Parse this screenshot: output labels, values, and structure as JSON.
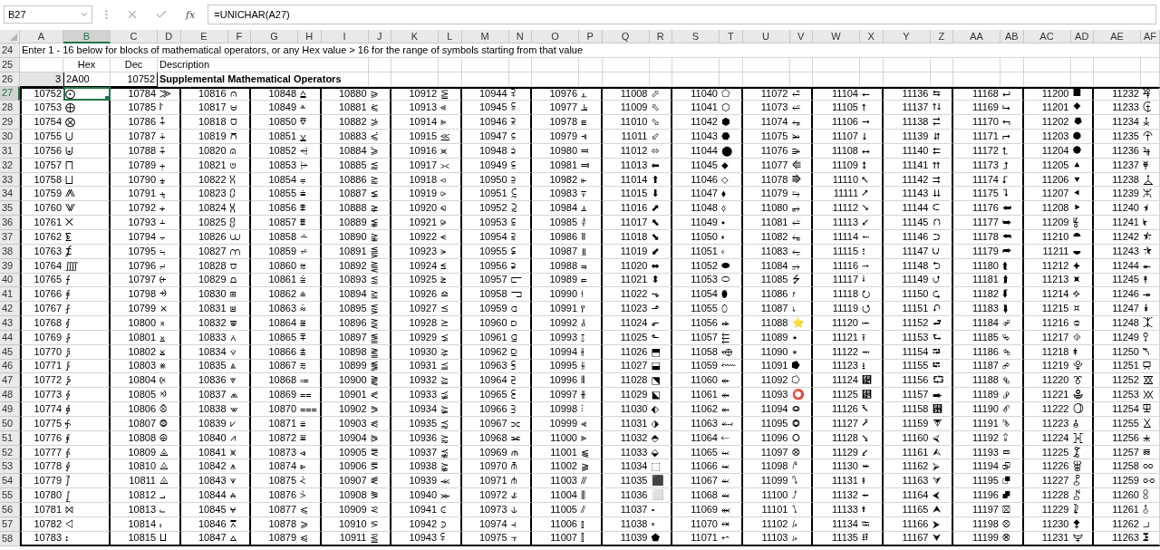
{
  "formula_bar": {
    "name_box": "B27",
    "function_label": "fx",
    "formula": "=UNICHAR(A27)"
  },
  "columns": [
    {
      "label": "A",
      "selected": false
    },
    {
      "label": "B",
      "selected": true
    },
    {
      "label": "C",
      "selected": false
    },
    {
      "label": "D",
      "selected": false
    },
    {
      "label": "E",
      "selected": false
    },
    {
      "label": "F",
      "selected": false
    },
    {
      "label": "G",
      "selected": false
    },
    {
      "label": "H",
      "selected": false
    },
    {
      "label": "I",
      "selected": false
    },
    {
      "label": "J",
      "selected": false
    },
    {
      "label": "K",
      "selected": false
    },
    {
      "label": "L",
      "selected": false
    },
    {
      "label": "M",
      "selected": false
    },
    {
      "label": "N",
      "selected": false
    },
    {
      "label": "O",
      "selected": false
    },
    {
      "label": "P",
      "selected": false
    },
    {
      "label": "Q",
      "selected": false
    },
    {
      "label": "R",
      "selected": false
    },
    {
      "label": "S",
      "selected": false
    },
    {
      "label": "T",
      "selected": false
    },
    {
      "label": "U",
      "selected": false
    },
    {
      "label": "V",
      "selected": false
    },
    {
      "label": "W",
      "selected": false
    },
    {
      "label": "X",
      "selected": false
    },
    {
      "label": "Y",
      "selected": false
    },
    {
      "label": "Z",
      "selected": false
    },
    {
      "label": "AA",
      "selected": false
    },
    {
      "label": "AB",
      "selected": false
    },
    {
      "label": "AC",
      "selected": false
    },
    {
      "label": "AD",
      "selected": false
    },
    {
      "label": "AE",
      "selected": false
    },
    {
      "label": "AF",
      "selected": false
    }
  ],
  "rows": [
    {
      "kind": "note",
      "number": "24",
      "selected": false,
      "text": "Enter 1 - 16 below for blocks of mathematical operators, or any Hex value > 16 for the range of symbols starting from that value"
    },
    {
      "kind": "labels",
      "number": "25",
      "selected": false,
      "hex": "Hex",
      "dec": "Dec",
      "description": "Description"
    },
    {
      "kind": "input",
      "number": "26",
      "selected": false,
      "block": "3",
      "hex": "2A00",
      "dec": "10752",
      "description": "Supplemental Mathematical Operators"
    },
    {
      "kind": "data",
      "number": "27",
      "selected": true,
      "cells": [
        "10752",
        "⨀",
        "10784",
        "⨠",
        "10816",
        "⩀",
        "10848",
        "⩠",
        "10880",
        "⪀",
        "10912",
        "⪠",
        "10944",
        "⫀",
        "10976",
        "⫠",
        "11008",
        "⬀",
        "11040",
        "⬠",
        "11072",
        "⭀",
        "11104",
        "⭠",
        "11136",
        "⮀",
        "11168",
        "⮠",
        "11200",
        "⯀",
        "11232",
        "⯠"
      ]
    },
    {
      "kind": "data",
      "number": "28",
      "selected": false,
      "cells": [
        "10753",
        "⨁",
        "10785",
        "⨡",
        "10817",
        "⩁",
        "10849",
        "⩡",
        "10881",
        "⪁",
        "10913",
        "⪡",
        "10945",
        "⫁",
        "10977",
        "⫡",
        "11009",
        "⬁",
        "11041",
        "⬡",
        "11073",
        "⭁",
        "11105",
        "⭡",
        "11137",
        "⮁",
        "11169",
        "⮡",
        "11201",
        "⯁",
        "11233",
        "⯡"
      ]
    },
    {
      "kind": "data",
      "number": "29",
      "selected": false,
      "cells": [
        "10754",
        "⨂",
        "10786",
        "⨢",
        "10818",
        "⩂",
        "10850",
        "⩢",
        "10882",
        "⪂",
        "10914",
        "⪢",
        "10946",
        "⫂",
        "10978",
        "⫢",
        "11010",
        "⬂",
        "11042",
        "⬢",
        "11074",
        "⭂",
        "11106",
        "⭢",
        "11138",
        "⮂",
        "11170",
        "⮢",
        "11202",
        "⯂",
        "11234",
        "⯢"
      ]
    },
    {
      "kind": "data",
      "number": "30",
      "selected": false,
      "cells": [
        "10755",
        "⨃",
        "10787",
        "⨣",
        "10819",
        "⩃",
        "10851",
        "⩣",
        "10883",
        "⪃",
        "10915",
        "⪣",
        "10947",
        "⫃",
        "10979",
        "⫣",
        "11011",
        "⬃",
        "11043",
        "⬣",
        "11075",
        "⭃",
        "11107",
        "⭣",
        "11139",
        "⮃",
        "11171",
        "⮣",
        "11203",
        "⯃",
        "11235",
        "⯣"
      ]
    },
    {
      "kind": "data",
      "number": "31",
      "selected": false,
      "cells": [
        "10756",
        "⨄",
        "10788",
        "⨤",
        "10820",
        "⩄",
        "10852",
        "⩤",
        "10884",
        "⪄",
        "10916",
        "⪤",
        "10948",
        "⫄",
        "10980",
        "⫤",
        "11012",
        "⬄",
        "11044",
        "⬤",
        "11076",
        "⭄",
        "11108",
        "⭤",
        "11140",
        "⮄",
        "11172",
        "⮤",
        "11204",
        "⯄",
        "11236",
        "⯤"
      ]
    },
    {
      "kind": "data",
      "number": "32",
      "selected": false,
      "cells": [
        "10757",
        "⨅",
        "10789",
        "⨥",
        "10821",
        "⩅",
        "10853",
        "⩥",
        "10885",
        "⪅",
        "10917",
        "⪥",
        "10949",
        "⫅",
        "10981",
        "⫥",
        "11013",
        "⬅",
        "11045",
        "⬥",
        "11077",
        "⭅",
        "11109",
        "⭥",
        "11141",
        "⮅",
        "11173",
        "⮥",
        "11205",
        "⯅",
        "11237",
        "⯥"
      ]
    },
    {
      "kind": "data",
      "number": "33",
      "selected": false,
      "cells": [
        "10758",
        "⨆",
        "10790",
        "⨦",
        "10822",
        "⩆",
        "10854",
        "⩦",
        "10886",
        "⪆",
        "10918",
        "⪦",
        "10950",
        "⫆",
        "10982",
        "⫦",
        "11014",
        "⬆",
        "11046",
        "⬦",
        "11078",
        "⭆",
        "11110",
        "⭦",
        "11142",
        "⮆",
        "11174",
        "⮦",
        "11206",
        "⯆",
        "11238",
        "⯦"
      ]
    },
    {
      "kind": "data",
      "number": "34",
      "selected": false,
      "cells": [
        "10759",
        "⨇",
        "10791",
        "⨧",
        "10823",
        "⩇",
        "10855",
        "⩧",
        "10887",
        "⪇",
        "10919",
        "⪧",
        "10951",
        "⫇",
        "10983",
        "⫧",
        "11015",
        "⬇",
        "11047",
        "⬧",
        "11079",
        "⭇",
        "11111",
        "⭧",
        "11143",
        "⮇",
        "11175",
        "⮧",
        "11207",
        "⯇",
        "11239",
        "⯧"
      ]
    },
    {
      "kind": "data",
      "number": "35",
      "selected": false,
      "cells": [
        "10760",
        "⨈",
        "10792",
        "⨨",
        "10824",
        "⩈",
        "10856",
        "⩨",
        "10888",
        "⪈",
        "10920",
        "⪨",
        "10952",
        "⫈",
        "10984",
        "⫨",
        "11016",
        "⬈",
        "11048",
        "⬨",
        "11080",
        "⭈",
        "11112",
        "⭨",
        "11144",
        "⮈",
        "11176",
        "⮨",
        "11208",
        "⯈",
        "11240",
        "⯨"
      ]
    },
    {
      "kind": "data",
      "number": "36",
      "selected": false,
      "cells": [
        "10761",
        "⨉",
        "10793",
        "⨩",
        "10825",
        "⩉",
        "10857",
        "⩩",
        "10889",
        "⪉",
        "10921",
        "⪩",
        "10953",
        "⫉",
        "10985",
        "⫩",
        "11017",
        "⬉",
        "11049",
        "⬩",
        "11081",
        "⭉",
        "11113",
        "⭩",
        "11145",
        "⮉",
        "11177",
        "⮩",
        "11209",
        "⯉",
        "11241",
        "⯩"
      ]
    },
    {
      "kind": "data",
      "number": "37",
      "selected": false,
      "cells": [
        "10762",
        "⨊",
        "10794",
        "⨪",
        "10826",
        "⩊",
        "10858",
        "⩪",
        "10890",
        "⪊",
        "10922",
        "⪪",
        "10954",
        "⫊",
        "10986",
        "⫪",
        "11018",
        "⬊",
        "11050",
        "⬪",
        "11082",
        "⭊",
        "11114",
        "⭪",
        "11146",
        "⮊",
        "11178",
        "⮪",
        "11210",
        "⯊",
        "11242",
        "⯪"
      ]
    },
    {
      "kind": "data",
      "number": "38",
      "selected": false,
      "cells": [
        "10763",
        "⨋",
        "10795",
        "⨫",
        "10827",
        "⩋",
        "10859",
        "⩫",
        "10891",
        "⪋",
        "10923",
        "⪫",
        "10955",
        "⫋",
        "10987",
        "⫫",
        "11019",
        "⬋",
        "11051",
        "⬫",
        "11083",
        "⭋",
        "11115",
        "⭫",
        "11147",
        "⮋",
        "11179",
        "⮫",
        "11211",
        "⯋",
        "11243",
        "⯫"
      ]
    },
    {
      "kind": "data",
      "number": "39",
      "selected": false,
      "cells": [
        "10764",
        "⨌",
        "10796",
        "⨬",
        "10828",
        "⩌",
        "10860",
        "⩬",
        "10892",
        "⪌",
        "10924",
        "⪬",
        "10956",
        "⫌",
        "10988",
        "⫬",
        "11020",
        "⬌",
        "11052",
        "⬬",
        "11084",
        "⭌",
        "11116",
        "⭬",
        "11148",
        "⮌",
        "11180",
        "⮬",
        "11212",
        "⯌",
        "11244",
        "⯬"
      ]
    },
    {
      "kind": "data",
      "number": "40",
      "selected": false,
      "cells": [
        "10765",
        "⨍",
        "10797",
        "⨭",
        "10829",
        "⩍",
        "10861",
        "⩭",
        "10893",
        "⪍",
        "10925",
        "⪭",
        "10957",
        "⫍",
        "10989",
        "⫭",
        "11021",
        "⬍",
        "11053",
        "⬭",
        "11085",
        "⭍",
        "11117",
        "⭭",
        "11149",
        "⮍",
        "11181",
        "⮭",
        "11213",
        "⯍",
        "11245",
        "⯭"
      ]
    },
    {
      "kind": "data",
      "number": "41",
      "selected": false,
      "cells": [
        "10766",
        "⨎",
        "10798",
        "⨮",
        "10830",
        "⩎",
        "10862",
        "⩮",
        "10894",
        "⪎",
        "10926",
        "⪮",
        "10958",
        "⫎",
        "10990",
        "⫮",
        "11022",
        "⬎",
        "11054",
        "⬮",
        "11086",
        "⭎",
        "11118",
        "⭮",
        "11150",
        "⮎",
        "11182",
        "⮮",
        "11214",
        "⯎",
        "11246",
        "⯮"
      ]
    },
    {
      "kind": "data",
      "number": "42",
      "selected": false,
      "cells": [
        "10767",
        "⨏",
        "10799",
        "⨯",
        "10831",
        "⩏",
        "10863",
        "⩯",
        "10895",
        "⪏",
        "10927",
        "⪯",
        "10959",
        "⫏",
        "10991",
        "⫯",
        "11023",
        "⬏",
        "11055",
        "⬯",
        "11087",
        "⭏",
        "11119",
        "⭯",
        "11151",
        "⮏",
        "11183",
        "⮯",
        "11215",
        "⯏",
        "11247",
        "⯯"
      ]
    },
    {
      "kind": "data",
      "number": "43",
      "selected": false,
      "cells": [
        "10768",
        "⨐",
        "10800",
        "⨰",
        "10832",
        "⩐",
        "10864",
        "⩰",
        "10896",
        "⪐",
        "10928",
        "⪰",
        "10960",
        "⫐",
        "10992",
        "⫰",
        "11024",
        "⬐",
        "11056",
        "⬰",
        "11088",
        "⭐",
        "11120",
        "⭰",
        "11152",
        "⮐",
        "11184",
        "⮰",
        "11216",
        "⯐",
        "11248",
        "⯰"
      ]
    },
    {
      "kind": "data",
      "number": "44",
      "selected": false,
      "cells": [
        "10769",
        "⨑",
        "10801",
        "⨱",
        "10833",
        "⩑",
        "10865",
        "⩱",
        "10897",
        "⪑",
        "10929",
        "⪱",
        "10961",
        "⫑",
        "10993",
        "⫱",
        "11025",
        "⬑",
        "11057",
        "⬱",
        "11089",
        "⭑",
        "11121",
        "⭱",
        "11153",
        "⮑",
        "11185",
        "⮱",
        "11217",
        "⯑",
        "11249",
        "⯱"
      ]
    },
    {
      "kind": "data",
      "number": "45",
      "selected": false,
      "cells": [
        "10770",
        "⨒",
        "10802",
        "⨲",
        "10834",
        "⩒",
        "10866",
        "⩲",
        "10898",
        "⪒",
        "10930",
        "⪲",
        "10962",
        "⫒",
        "10994",
        "⫲",
        "11026",
        "⬒",
        "11058",
        "⬲",
        "11090",
        "⭒",
        "11122",
        "⭲",
        "11154",
        "⮒",
        "11186",
        "⮲",
        "11218",
        "⯒",
        "11250",
        "⯲"
      ]
    },
    {
      "kind": "data",
      "number": "46",
      "selected": false,
      "cells": [
        "10771",
        "⨓",
        "10803",
        "⨳",
        "10835",
        "⩓",
        "10867",
        "⩳",
        "10899",
        "⪓",
        "10931",
        "⪳",
        "10963",
        "⫓",
        "10995",
        "⫳",
        "11027",
        "⬓",
        "11059",
        "⬳",
        "11091",
        "⭓",
        "11123",
        "⭳",
        "11155",
        "⮓",
        "11187",
        "⮳",
        "11219",
        "⯓",
        "11251",
        "⯳"
      ]
    },
    {
      "kind": "data",
      "number": "47",
      "selected": false,
      "cells": [
        "10772",
        "⨔",
        "10804",
        "⨴",
        "10836",
        "⩔",
        "10868",
        "⩴",
        "10900",
        "⪔",
        "10932",
        "⪴",
        "10964",
        "⫔",
        "10996",
        "⫴",
        "11028",
        "⬔",
        "11060",
        "⬴",
        "11092",
        "⭔",
        "11124",
        "⭴",
        "11156",
        "⮔",
        "11188",
        "⮴",
        "11220",
        "⯔",
        "11252",
        "⯴"
      ]
    },
    {
      "kind": "data",
      "number": "48",
      "selected": false,
      "cells": [
        "10773",
        "⨕",
        "10805",
        "⨵",
        "10837",
        "⩕",
        "10869",
        "⩵",
        "10901",
        "⪕",
        "10933",
        "⪵",
        "10965",
        "⫕",
        "10997",
        "⫵",
        "11029",
        "⬕",
        "11061",
        "⬵",
        "11093",
        "⭕",
        "11125",
        "⭵",
        "11157",
        "⮕",
        "11189",
        "⮵",
        "11221",
        "⯕",
        "11253",
        "⯵"
      ]
    },
    {
      "kind": "data",
      "number": "49",
      "selected": false,
      "cells": [
        "10774",
        "⨖",
        "10806",
        "⨶",
        "10838",
        "⩖",
        "10870",
        "⩶",
        "10902",
        "⪖",
        "10934",
        "⪶",
        "10966",
        "⫖",
        "10998",
        "⫶",
        "11030",
        "⬖",
        "11062",
        "⬶",
        "11094",
        "⭖",
        "11126",
        "⭶",
        "11158",
        "⮖",
        "11190",
        "⮶",
        "11222",
        "⯖",
        "11254",
        "⯶"
      ]
    },
    {
      "kind": "data",
      "number": "50",
      "selected": false,
      "cells": [
        "10775",
        "⨗",
        "10807",
        "⨷",
        "10839",
        "⩗",
        "10871",
        "⩷",
        "10903",
        "⪗",
        "10935",
        "⪷",
        "10967",
        "⫗",
        "10999",
        "⫷",
        "11031",
        "⬗",
        "11063",
        "⬷",
        "11095",
        "⭗",
        "11127",
        "⭷",
        "11159",
        "⮗",
        "11191",
        "⮷",
        "11223",
        "⯗",
        "11255",
        "⯷"
      ]
    },
    {
      "kind": "data",
      "number": "51",
      "selected": false,
      "cells": [
        "10776",
        "⨘",
        "10808",
        "⨸",
        "10840",
        "⩘",
        "10872",
        "⩸",
        "10904",
        "⪘",
        "10936",
        "⪸",
        "10968",
        "⫘",
        "11000",
        "⫸",
        "11032",
        "⬘",
        "11064",
        "⬸",
        "11096",
        "⭘",
        "11128",
        "⭸",
        "11160",
        "⮘",
        "11192",
        "⮸",
        "11224",
        "⯘",
        "11256",
        "⯸"
      ]
    },
    {
      "kind": "data",
      "number": "52",
      "selected": false,
      "cells": [
        "10777",
        "⨙",
        "10809",
        "⨹",
        "10841",
        "⩙",
        "10873",
        "⩹",
        "10905",
        "⪙",
        "10937",
        "⪹",
        "10969",
        "⫙",
        "11001",
        "⫹",
        "11033",
        "⬙",
        "11065",
        "⬹",
        "11097",
        "⭙",
        "11129",
        "⭹",
        "11161",
        "⮙",
        "11193",
        "⮹",
        "11225",
        "⯙",
        "11257",
        "⯹"
      ]
    },
    {
      "kind": "data",
      "number": "53",
      "selected": false,
      "cells": [
        "10778",
        "⨚",
        "10810",
        "⨺",
        "10842",
        "⩚",
        "10874",
        "⩺",
        "10906",
        "⪚",
        "10938",
        "⪺",
        "10970",
        "⫚",
        "11002",
        "⫺",
        "11034",
        "⬚",
        "11066",
        "⬺",
        "11098",
        "⭚",
        "11130",
        "⭺",
        "11162",
        "⮚",
        "11194",
        "⮺",
        "11226",
        "⯚",
        "11258",
        "⯺"
      ]
    },
    {
      "kind": "data",
      "number": "54",
      "selected": false,
      "cells": [
        "10779",
        "⨛",
        "10811",
        "⨻",
        "10843",
        "⩛",
        "10875",
        "⩻",
        "10907",
        "⪛",
        "10939",
        "⪻",
        "10971",
        "⫛",
        "11003",
        "⫻",
        "11035",
        "⬛",
        "11067",
        "⬻",
        "11099",
        "⭛",
        "11131",
        "⭻",
        "11163",
        "⮛",
        "11195",
        "⮻",
        "11227",
        "⯛",
        "11259",
        "⯻"
      ]
    },
    {
      "kind": "data",
      "number": "55",
      "selected": false,
      "cells": [
        "10780",
        "⨜",
        "10812",
        "⨼",
        "10844",
        "⩜",
        "10876",
        "⩼",
        "10908",
        "⪜",
        "10940",
        "⪼",
        "10972",
        "⫝̸",
        "11004",
        "⫼",
        "11036",
        "⬜",
        "11068",
        "⬼",
        "11100",
        "⭜",
        "11132",
        "⭼",
        "11164",
        "⮜",
        "11196",
        "⮼",
        "11228",
        "⯜",
        "11260",
        "⯼"
      ]
    },
    {
      "kind": "data",
      "number": "56",
      "selected": false,
      "cells": [
        "10781",
        "⨝",
        "10813",
        "⨽",
        "10845",
        "⩝",
        "10877",
        "⩽",
        "10909",
        "⪝",
        "10941",
        "⪽",
        "10973",
        "⫝",
        "11005",
        "⫽",
        "11037",
        "⬝",
        "11069",
        "⬽",
        "11101",
        "⭝",
        "11133",
        "⭽",
        "11165",
        "⮝",
        "11197",
        "⮽",
        "11229",
        "⯝",
        "11261",
        "⯽"
      ]
    },
    {
      "kind": "data",
      "number": "57",
      "selected": false,
      "cells": [
        "10782",
        "⨞",
        "10814",
        "⨾",
        "10846",
        "⩞",
        "10878",
        "⩾",
        "10910",
        "⪞",
        "10942",
        "⪾",
        "10974",
        "⫞",
        "11006",
        "⫾",
        "11038",
        "⬞",
        "11070",
        "⬾",
        "11102",
        "⭞",
        "11134",
        "⭾",
        "11166",
        "⮞",
        "11198",
        "⮾",
        "11230",
        "⯞",
        "11262",
        "⯾"
      ]
    },
    {
      "kind": "data",
      "number": "58",
      "selected": false,
      "cells": [
        "10783",
        "⨟",
        "10815",
        "⨿",
        "10847",
        "⩟",
        "10879",
        "⩿",
        "10911",
        "⪟",
        "10943",
        "⪿",
        "10975",
        "⫟",
        "11007",
        "⫿",
        "11039",
        "⬟",
        "11071",
        "⬿",
        "11103",
        "⭟",
        "11135",
        "⭿",
        "11167",
        "⮟",
        "11199",
        "⮿",
        "11231",
        "⯟",
        "11263",
        "⯿"
      ]
    }
  ]
}
